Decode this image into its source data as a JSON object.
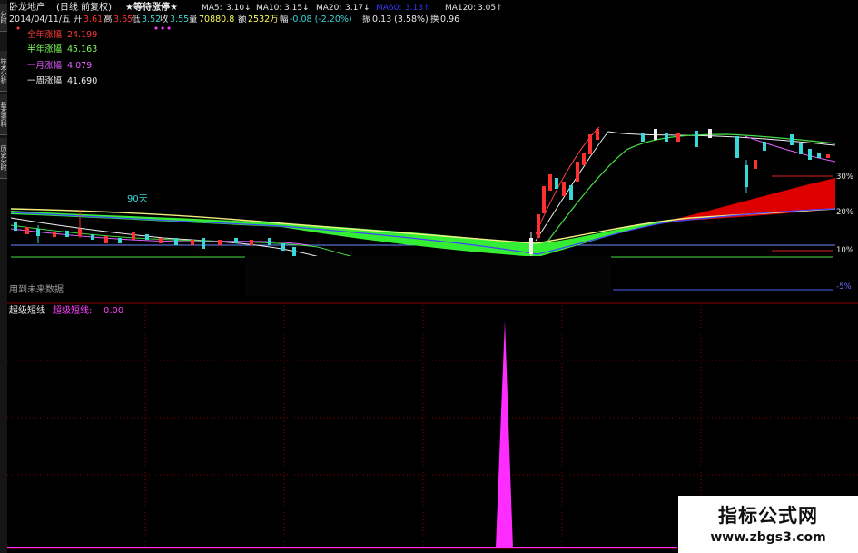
{
  "header": {
    "stock_name": "卧龙地产",
    "period": "(日线 前复权)",
    "indicator_title": "★等待涨停★",
    "ma": [
      {
        "label": "MA5:",
        "value": "3.10↓",
        "color": "#e8e8e8"
      },
      {
        "label": "MA10:",
        "value": "3.15↓",
        "color": "#e8e8e8"
      },
      {
        "label": "MA20:",
        "value": "3.17↓",
        "color": "#e8e8e8"
      },
      {
        "label": "MA60:",
        "value": "3.13↑",
        "color": "#3b3bff"
      },
      {
        "label": "MA120:",
        "value": "3.05↑",
        "color": "#e8e8e8"
      }
    ]
  },
  "quote": {
    "date": "2014/04/11/五",
    "open_label": "开",
    "open": "3.61",
    "high_label": "高",
    "high": "3.65",
    "low_label": "低",
    "low": "3.52",
    "close_label": "收",
    "close": "3.55",
    "vol_label": "量",
    "vol": "70880.8",
    "amount_label": "额",
    "amount": "2532万",
    "change_label": "幅",
    "change": "-0.08 (-2.20%)",
    "amplitude_label": "振",
    "amplitude": "0.13 (3.58%)",
    "turnover_label": "换",
    "turnover": "0.96"
  },
  "legend": [
    {
      "label": "全年涨幅",
      "value": "24.199",
      "color": "#ff3a3a"
    },
    {
      "label": "半年涨幅",
      "value": "45.163",
      "color": "#7cff5a"
    },
    {
      "label": "一月涨幅",
      "value": "4.079",
      "color": "#e060ff"
    },
    {
      "label": "一周涨幅",
      "value": "41.690",
      "color": "#f0f0f0"
    }
  ],
  "annotations": {
    "days_label": "90天",
    "future_data": "用到未来数据",
    "pct_30": "30%",
    "pct_20": "20%",
    "pct_10": "10%",
    "pct_neg": "-5%"
  },
  "lower_panel": {
    "title": "超级短线",
    "series_label": "超级短线:",
    "value": "0.00",
    "line_color": "#ff2cff"
  },
  "left_tabs": [
    "分时",
    "技术分析",
    "基本资料",
    "历史分时"
  ],
  "watermark": {
    "line1": "指标公式网",
    "line2": "www.zbgs3.com"
  },
  "colors": {
    "up": "#ff3030",
    "down": "#38d8d8",
    "ribbon_green": "#33ee33",
    "ribbon_red": "#dd0000",
    "yellow_line": "#f0f080",
    "grid": "#8a0000"
  }
}
